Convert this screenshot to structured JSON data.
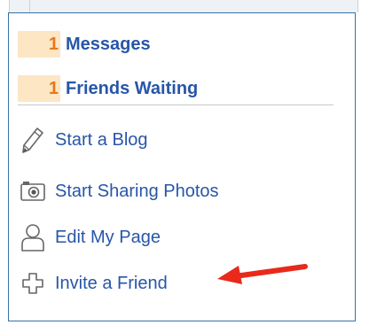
{
  "notifications": [
    {
      "count": "1",
      "label": "Messages"
    },
    {
      "count": "1",
      "label": "Friends Waiting"
    }
  ],
  "links": [
    {
      "icon": "pencil-icon",
      "label": "Start a Blog"
    },
    {
      "icon": "camera-icon",
      "label": "Start Sharing Photos"
    },
    {
      "icon": "person-icon",
      "label": "Edit My Page"
    },
    {
      "icon": "plus-icon",
      "label": "Invite a Friend"
    }
  ],
  "colors": {
    "link": "#2756a8",
    "count": "#e8771c",
    "count_bg": "#fde6c4",
    "border": "#3a6fa8",
    "arrow": "#e8291c"
  }
}
